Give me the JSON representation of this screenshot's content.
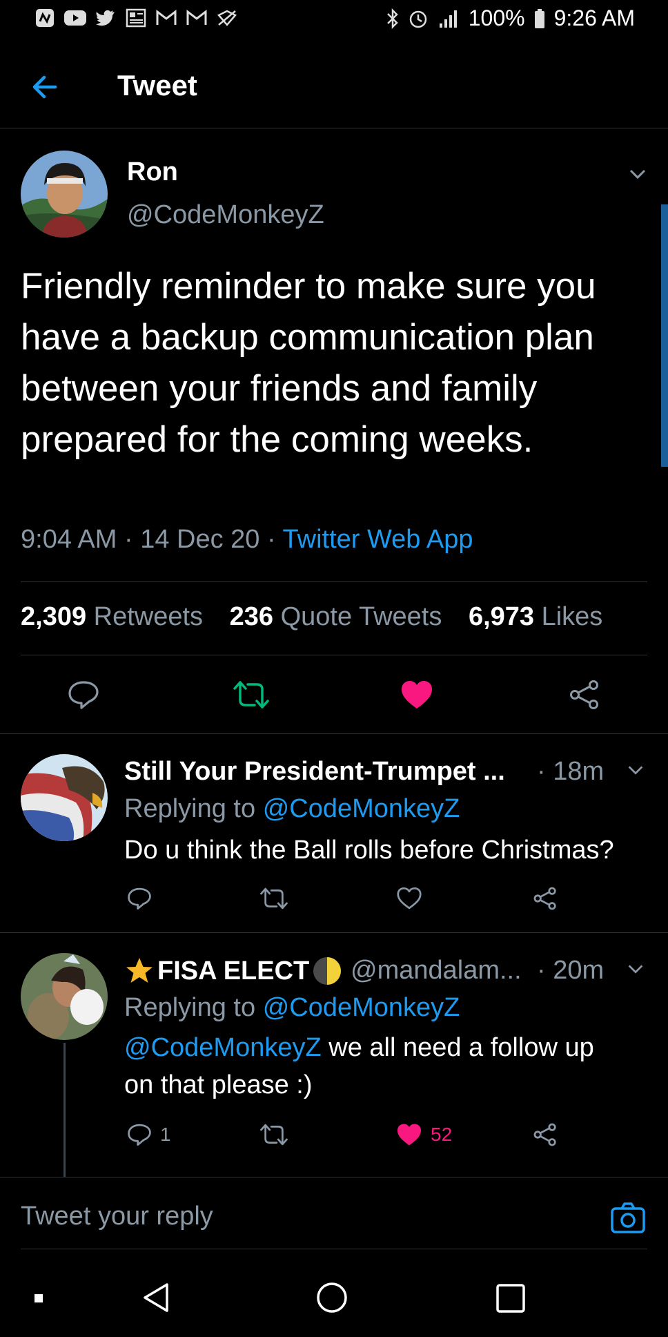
{
  "status_bar": {
    "battery": "100%",
    "time": "9:26 AM",
    "left_icons": [
      "app-icon",
      "youtube-icon",
      "twitter-icon",
      "news-icon",
      "gmail-icon",
      "gmail-icon-2",
      "sync-icon"
    ],
    "right_icons": [
      "bluetooth-icon",
      "alarm-icon",
      "lte-signal-icon",
      "battery-icon"
    ]
  },
  "header": {
    "title": "Tweet",
    "back_icon": "arrow-left-icon"
  },
  "tweet": {
    "author_name": "Ron",
    "author_handle": "@CodeMonkeyZ",
    "text": "Friendly reminder to make sure you have a backup communication plan between your friends and family prepared for the coming weeks.",
    "time": "9:04 AM",
    "date": "14 Dec 20",
    "source": "Twitter Web App",
    "retweets": "2,309",
    "retweets_label": "Retweets",
    "quotes": "236",
    "quotes_label": "Quote Tweets",
    "likes": "6,973",
    "likes_label": "Likes"
  },
  "replies": [
    {
      "name": "Still Your President-Trumpet ...",
      "handle": "",
      "time": "· 18m",
      "replying_label": "Replying to",
      "replying_to": "@CodeMonkeyZ",
      "text_mention": "",
      "text": "Do u think the Ball rolls before Christmas?",
      "reply_count": "",
      "like_count": ""
    },
    {
      "name": "FISA ELECT",
      "handle": "@mandalam...",
      "time": "· 20m",
      "replying_label": "Replying to",
      "replying_to": "@CodeMonkeyZ",
      "text_mention": "@CodeMonkeyZ",
      "text": "we all need a follow up",
      "text_line2": "on that please :)",
      "reply_count": "1",
      "like_count": "52"
    }
  ],
  "composer": {
    "placeholder": "Tweet your reply"
  },
  "colors": {
    "accent": "#1d9bf0",
    "like": "#f91880",
    "retweet": "#00ba7c",
    "background": "#000000"
  }
}
